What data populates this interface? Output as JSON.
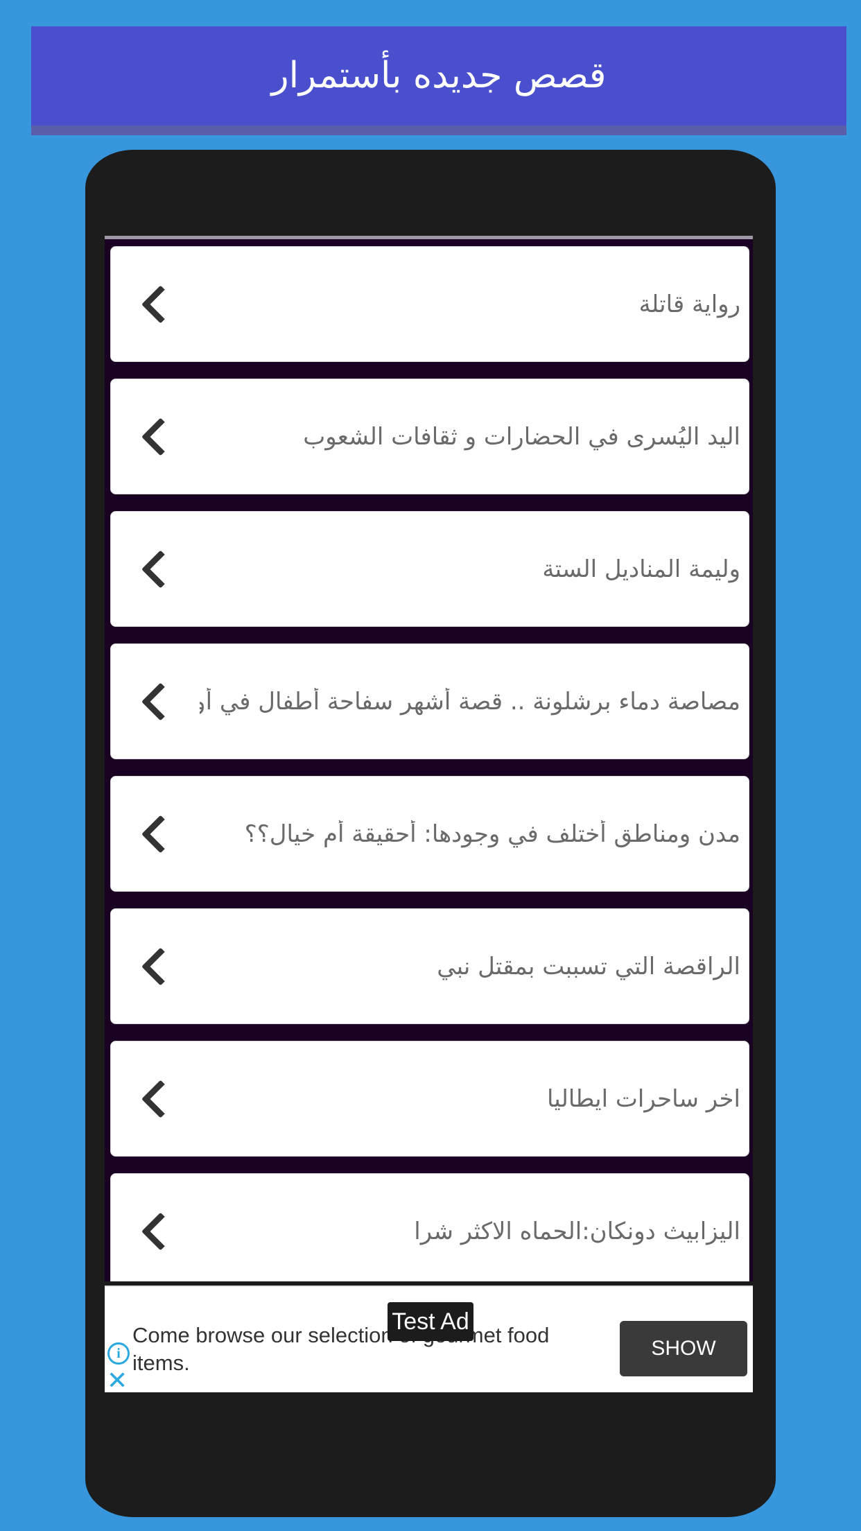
{
  "header": {
    "title": "قصص جديده بأستمرار"
  },
  "stories": [
    {
      "label": "رواية قاتلة"
    },
    {
      "label": "اليد اليُسرى في الحضارات و ثقافات الشعوب"
    },
    {
      "label": "وليمة المناديل الستة"
    },
    {
      "label": "مصاصة دماء برشلونة .. قصة أشهر سفاحة أطفال في أوربا"
    },
    {
      "label": "مدن ومناطق أختلف في وجودها: أحقيقة أم خيال؟؟"
    },
    {
      "label": "الراقصة التي تسببت بمقتل نبي"
    },
    {
      "label": "اخر ساحرات ايطاليا"
    },
    {
      "label": "اليزابيث دونكان:الحماه الاكثر شرا"
    }
  ],
  "ad": {
    "badge": "Test Ad",
    "text": "Come browse our selection of gourmet food items.",
    "button_label": "SHOW"
  },
  "icons": {
    "info": "info-icon",
    "close": "close-icon",
    "chevron": "chevron-left-icon"
  },
  "colors": {
    "background": "#3796dc",
    "header": "#4a4fce",
    "phone_frame": "#1c1c1c",
    "list_background": "#1a0022"
  }
}
